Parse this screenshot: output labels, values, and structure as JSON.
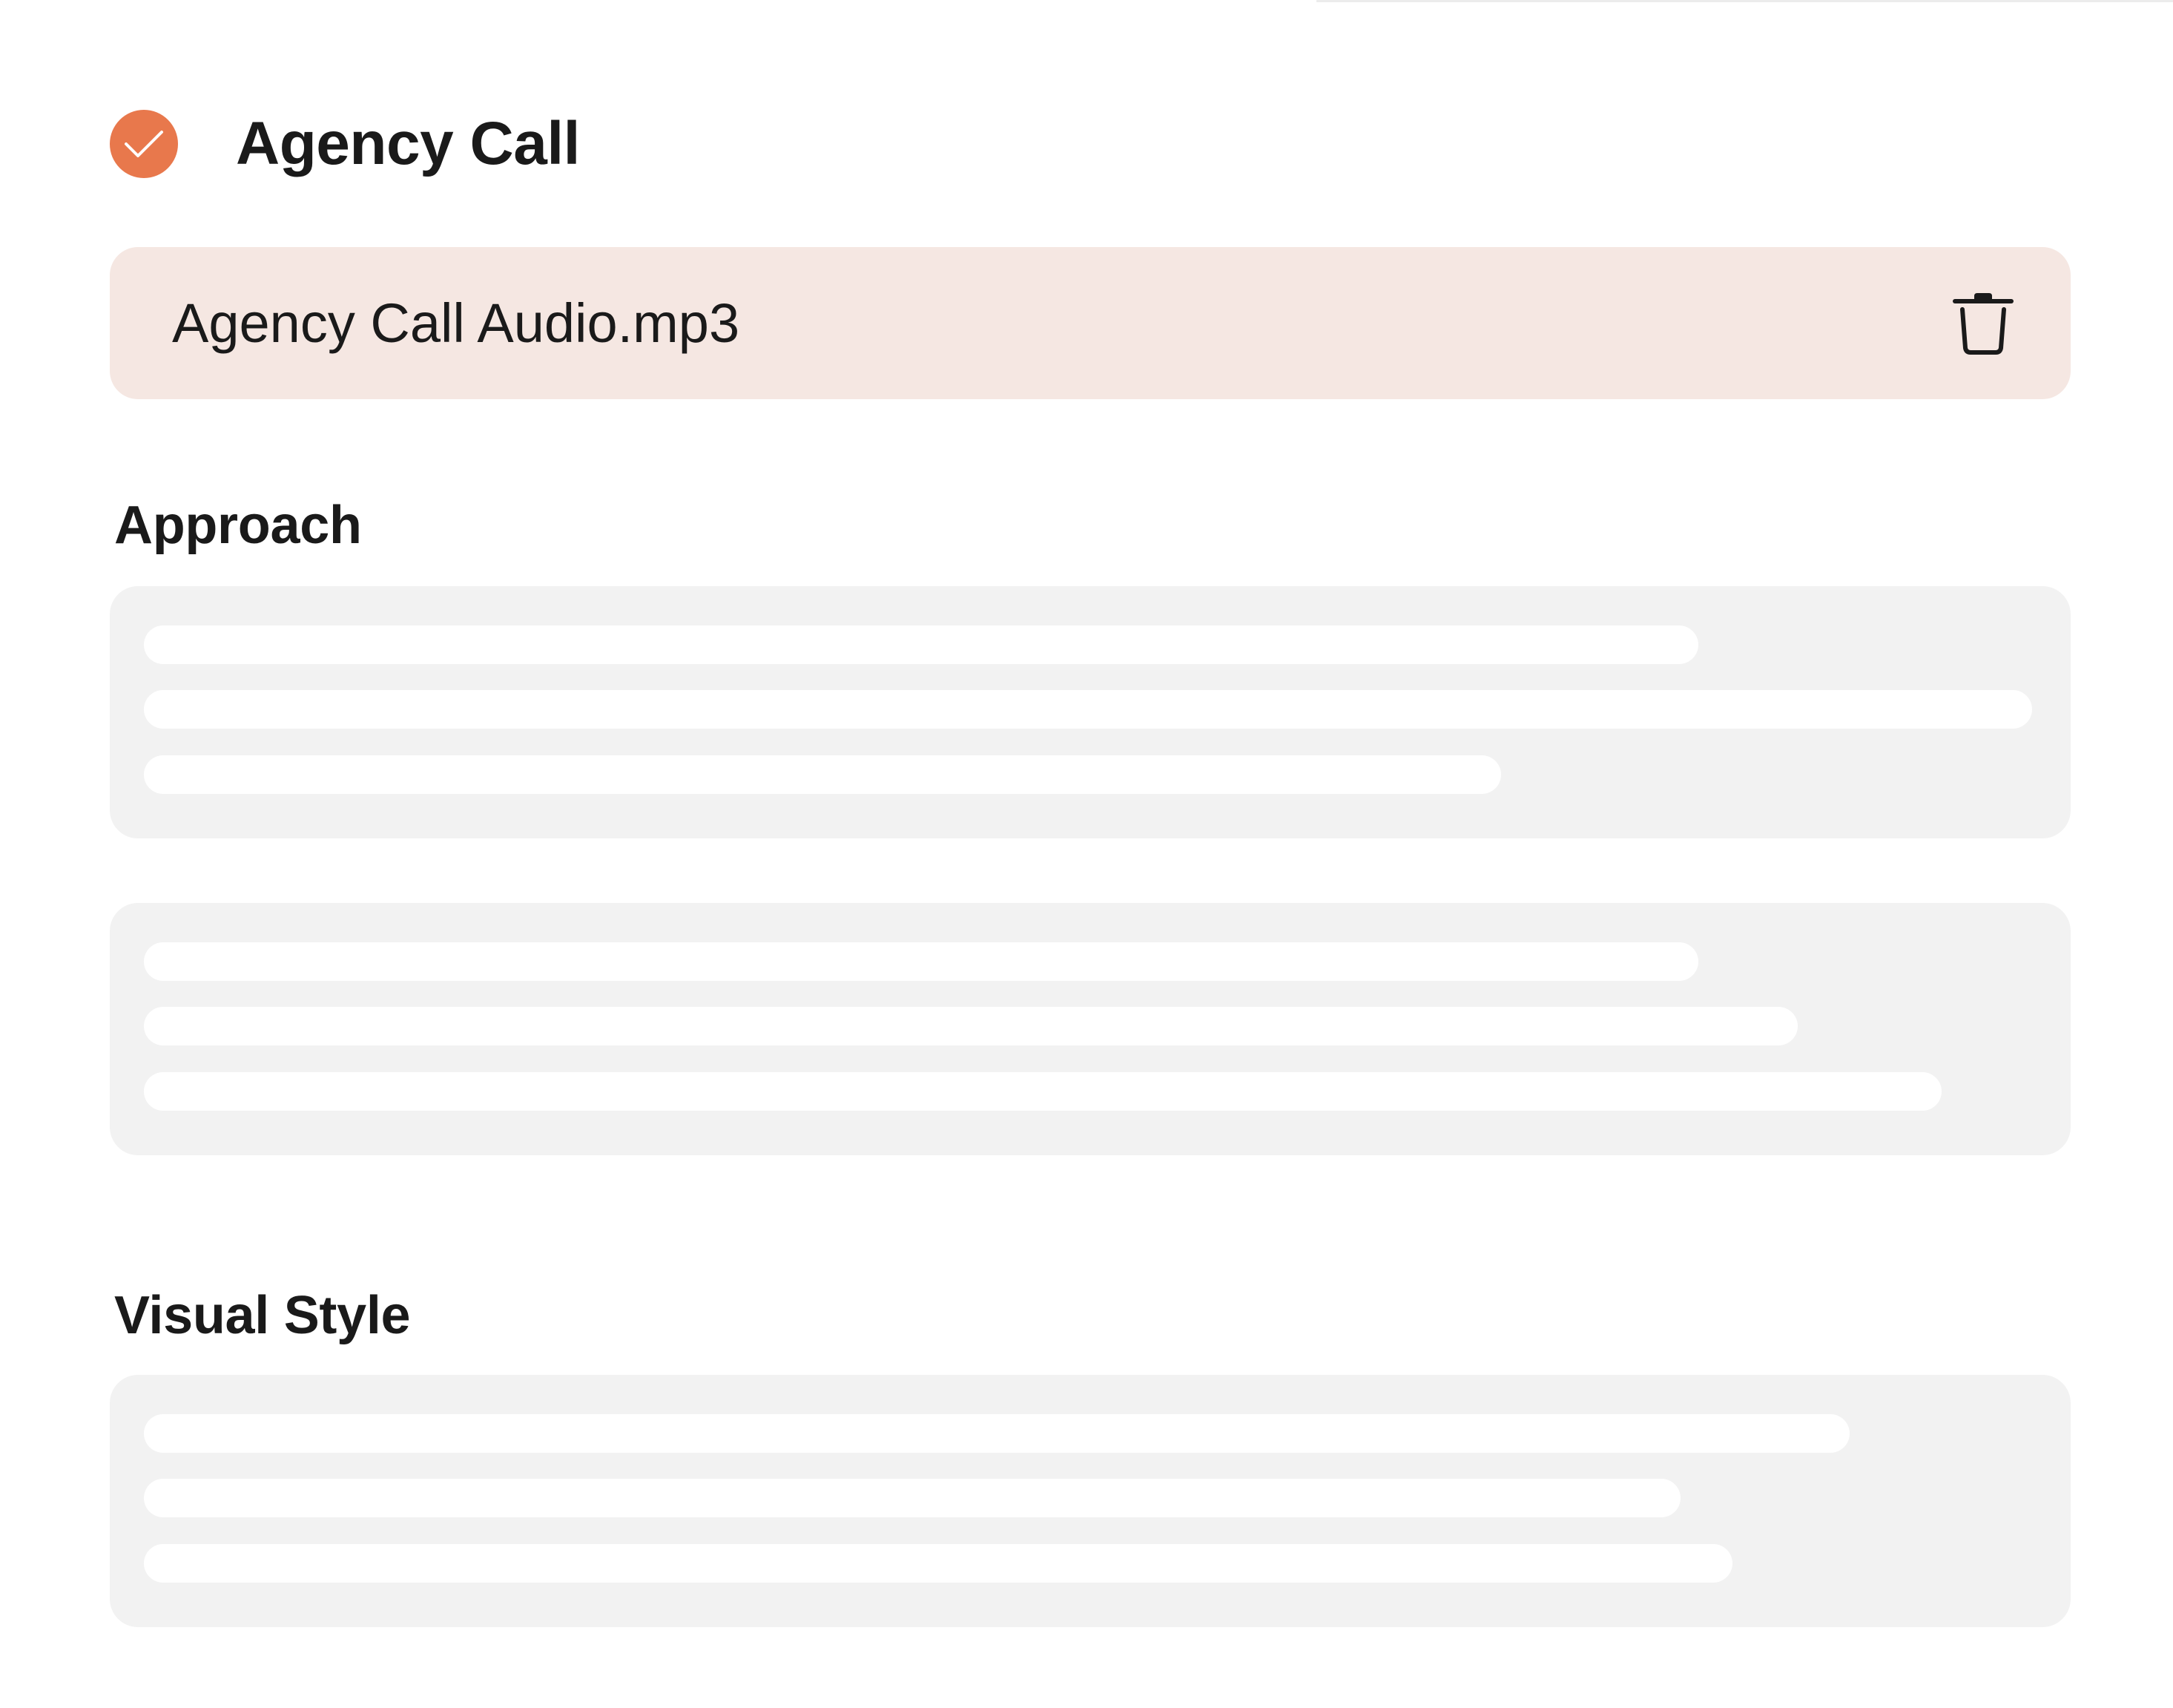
{
  "task": {
    "title": "Agency Call",
    "status_icon": "check-circle-icon",
    "accent_color": "#e8784c"
  },
  "attachment": {
    "file_name": "Agency Call Audio.mp3",
    "delete_icon": "trash-icon",
    "background_color": "#f5e7e2"
  },
  "sections": {
    "approach": {
      "heading": "Approach"
    },
    "visual_style": {
      "heading": "Visual Style"
    }
  },
  "placeholders": {
    "state": "loading",
    "card_color": "#f2f2f2",
    "line_color": "#ffffff"
  }
}
